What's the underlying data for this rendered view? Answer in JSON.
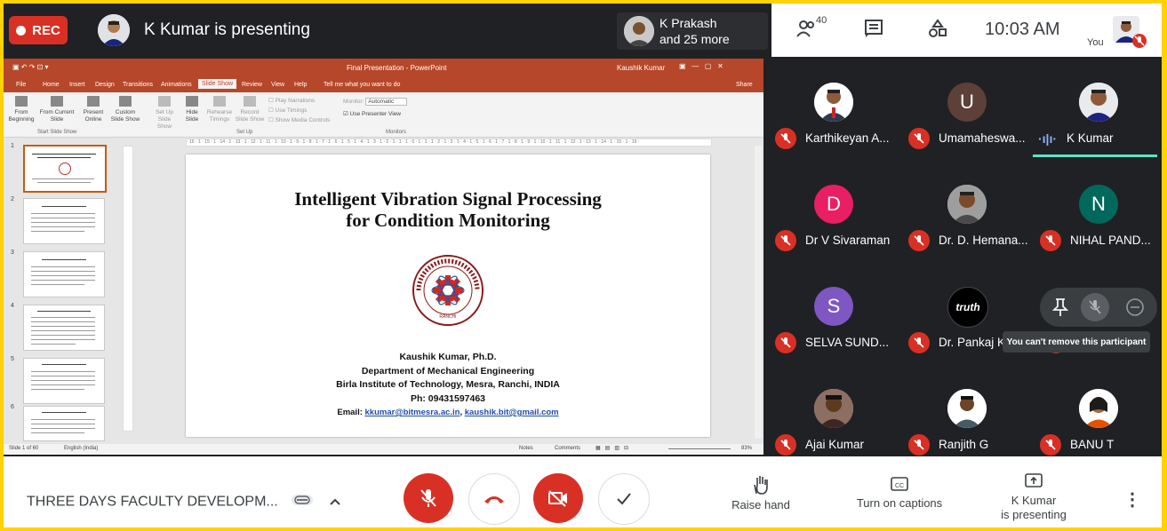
{
  "topbar": {
    "rec_label": "REC",
    "presenter_title": "K Kumar is presenting",
    "others_name": "K Prakash",
    "others_more": "and 25 more",
    "participant_count": "40",
    "time": "10:03 AM",
    "you_label": "You"
  },
  "ppt": {
    "window_title": "Final Presentation - PowerPoint",
    "user": "Kaushik Kumar",
    "menu": [
      "File",
      "Home",
      "Insert",
      "Design",
      "Transitions",
      "Animations",
      "Slide Show",
      "Review",
      "View",
      "Help",
      "Tell me what you want to do",
      "Share"
    ],
    "active_tab": "Slide Show",
    "ribbon": {
      "from_beginning": "From Beginning",
      "from_current": "From Current Slide",
      "present_online": "Present Online",
      "custom_show": "Custom Slide Show",
      "group_start": "Start Slide Show",
      "setup": "Set Up Slide Show",
      "hide_slide": "Hide Slide",
      "rehearse": "Rehearse Timings",
      "record": "Record Slide Show",
      "play_narr": "Play Narrations",
      "use_timings": "Use Timings",
      "show_media": "Show Media Controls",
      "group_setup": "Set Up",
      "monitor_label": "Monitor:",
      "monitor_value": "Automatic",
      "presenter_view": "Use Presenter View",
      "group_monitors": "Monitors"
    },
    "ruler": "· 16 · 1 · 15 · 1 · 14 · 1 · 13 · 1 · 12 · 1 · 11 · 1 · 10 · 1 · 9 · 1 · 8 · 1 · 7 · 1 · 6 · 1 · 5 · 1 · 4 · 1 · 3 · 1 · 2 · 1 · 1 · 1 · 0 · 1 · 1 · 1 · 2 · 1 · 3 · 1 · 4 · 1 · 5 · 1 · 6 · 1 · 7 · 1 · 8 · 1 · 9 · 1 · 10 · 1 · 11 · 1 · 12 · 1 · 13 · 1 · 14 · 1 · 15 · 1 · 16 ·",
    "slide": {
      "title_line1": "Intelligent Vibration Signal Processing",
      "title_line2": "for Condition Monitoring",
      "author": "Kaushik Kumar, Ph.D.",
      "dept": "Department of Mechanical Engineering",
      "institute": "Birla Institute of Technology, Mesra, Ranchi, INDIA",
      "phone": "Ph: 09431597463",
      "email_label": "Email:",
      "email1": "kkumar@bitmesra.ac.in",
      "email2": "kaushik.bit@gmail.com",
      "logo_text": "RANCHI"
    },
    "thumb_numbers": [
      "1",
      "2",
      "3",
      "4",
      "5",
      "6"
    ],
    "status_left": "Slide 1 of 60",
    "status_lang": "English (India)",
    "status_notes": "Notes",
    "status_comments": "Comments",
    "zoom": "83%"
  },
  "participants": [
    {
      "name": "Karthikeyan A...",
      "initial": "",
      "color": "#ffffff"
    },
    {
      "name": "Umamaheswa...",
      "initial": "U",
      "color": "#5d4037"
    },
    {
      "name": "K Kumar",
      "initial": "",
      "color": "#ffffff"
    },
    {
      "name": "Dr V Sivaraman",
      "initial": "D",
      "color": "#e91e63"
    },
    {
      "name": "Dr. D. Hemana...",
      "initial": "",
      "color": "#ffffff"
    },
    {
      "name": "NIHAL PAND...",
      "initial": "N",
      "color": "#00695c"
    },
    {
      "name": "SELVA SUND...",
      "initial": "S",
      "color": "#7e57c2"
    },
    {
      "name": "Dr. Pankaj K",
      "initial": "truth",
      "color": "#000000"
    },
    {
      "name": "",
      "initial": "",
      "color": "#ffffff"
    },
    {
      "name": "Ajai Kumar",
      "initial": "",
      "color": "#ffffff"
    },
    {
      "name": "Ranjith G",
      "initial": "",
      "color": "#ffffff"
    },
    {
      "name": "BANU T",
      "initial": "",
      "color": "#ffffff"
    }
  ],
  "tooltip": "You can't remove this participant",
  "bottombar": {
    "meeting_title": "THREE DAYS FACULTY DEVELOPM...",
    "raise_hand": "Raise hand",
    "captions": "Turn on captions",
    "presenting_line1": "K Kumar",
    "presenting_line2": "is presenting"
  },
  "colors": {
    "accent_red": "#d93025",
    "frame": "#ffd200",
    "ppt_red": "#b7472a"
  }
}
